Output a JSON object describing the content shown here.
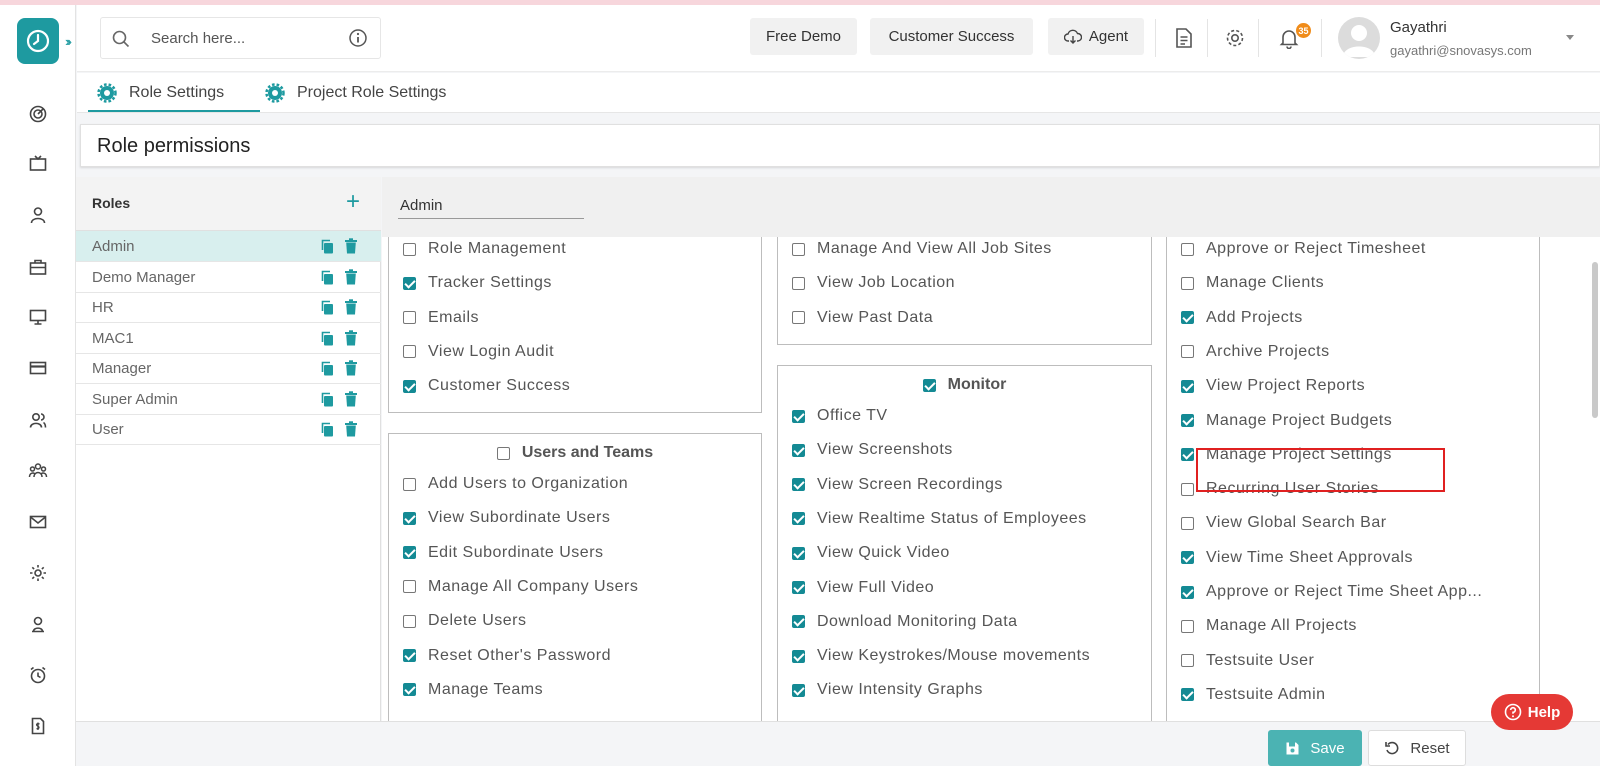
{
  "search": {
    "placeholder": "Search here..."
  },
  "header": {
    "free_demo": "Free Demo",
    "customer_success": "Customer Success",
    "agent": "Agent",
    "notification_count": "35",
    "user_name": "Gayathri",
    "user_email": "gayathri@snovasys.com"
  },
  "tabs": [
    {
      "label": "Role Settings",
      "active": true
    },
    {
      "label": "Project Role Settings",
      "active": false
    }
  ],
  "page_title": "Role permissions",
  "roles": {
    "title": "Roles",
    "add_symbol": "+",
    "items": [
      {
        "name": "Admin",
        "selected": true
      },
      {
        "name": "Demo Manager",
        "selected": false
      },
      {
        "name": "HR",
        "selected": false
      },
      {
        "name": "MAC1",
        "selected": false
      },
      {
        "name": "Manager",
        "selected": false
      },
      {
        "name": "Super Admin",
        "selected": false
      },
      {
        "name": "User",
        "selected": false
      }
    ]
  },
  "selected_role": "Admin",
  "columns": [
    {
      "boxes": [
        {
          "title": "",
          "items": [
            {
              "label": "Role Management",
              "checked": false
            },
            {
              "label": "Tracker Settings",
              "checked": true
            },
            {
              "label": "Emails",
              "checked": false
            },
            {
              "label": "View Login Audit",
              "checked": false
            },
            {
              "label": "Customer Success",
              "checked": true
            }
          ]
        },
        {
          "title": "Users and Teams",
          "title_checked": false,
          "items": [
            {
              "label": "Add Users to Organization",
              "checked": false
            },
            {
              "label": "View Subordinate Users",
              "checked": true
            },
            {
              "label": "Edit Subordinate Users",
              "checked": true
            },
            {
              "label": "Manage All Company Users",
              "checked": false
            },
            {
              "label": "Delete Users",
              "checked": false
            },
            {
              "label": "Reset Other's Password",
              "checked": true
            },
            {
              "label": "Manage Teams",
              "checked": true
            }
          ]
        }
      ]
    },
    {
      "boxes": [
        {
          "title": "",
          "items": [
            {
              "label": "Manage And View All Job Sites",
              "checked": false
            },
            {
              "label": "View Job Location",
              "checked": false
            },
            {
              "label": "View Past Data",
              "checked": false
            }
          ]
        },
        {
          "title": "Monitor",
          "title_checked": true,
          "items": [
            {
              "label": "Office TV",
              "checked": true
            },
            {
              "label": "View Screenshots",
              "checked": true
            },
            {
              "label": "View Screen Recordings",
              "checked": true
            },
            {
              "label": "View Realtime Status of Employees",
              "checked": true
            },
            {
              "label": "View Quick Video",
              "checked": true
            },
            {
              "label": "View Full Video",
              "checked": true
            },
            {
              "label": "Download Monitoring Data",
              "checked": true
            },
            {
              "label": "View Keystrokes/Mouse movements",
              "checked": true
            },
            {
              "label": "View Intensity Graphs",
              "checked": true
            }
          ]
        }
      ]
    },
    {
      "boxes": [
        {
          "title": "",
          "items": [
            {
              "label": "Approve or Reject Timesheet",
              "checked": false
            },
            {
              "label": "Manage Clients",
              "checked": false
            },
            {
              "label": "Add Projects",
              "checked": true
            },
            {
              "label": "Archive Projects",
              "checked": false
            },
            {
              "label": "View Project Reports",
              "checked": true
            },
            {
              "label": "Manage Project Budgets",
              "checked": true
            },
            {
              "label": "Manage Project Settings",
              "checked": true
            },
            {
              "label": "Recurring User Stories",
              "checked": false
            },
            {
              "label": "View Global Search Bar",
              "checked": false
            },
            {
              "label": "View Time Sheet Approvals",
              "checked": true
            },
            {
              "label": "Approve or Reject Time Sheet App...",
              "checked": true
            },
            {
              "label": "Manage All Projects",
              "checked": false
            },
            {
              "label": "Testsuite User",
              "checked": false
            },
            {
              "label": "Testsuite Admin",
              "checked": true
            }
          ]
        }
      ]
    }
  ],
  "footer": {
    "save": "Save",
    "reset": "Reset"
  },
  "help": "Help",
  "colors": {
    "accent": "#1e9aa0",
    "checkbox": "#148a94",
    "highlight": "#e02020",
    "help": "#e53935"
  },
  "icons": {
    "rail": [
      "dashboard-icon",
      "tv-icon",
      "user-icon",
      "briefcase-icon",
      "monitor-icon",
      "card-icon",
      "users-icon",
      "team-icon",
      "mail-icon",
      "settings-icon",
      "user-badge-icon",
      "alarm-icon",
      "invoice-icon"
    ]
  }
}
